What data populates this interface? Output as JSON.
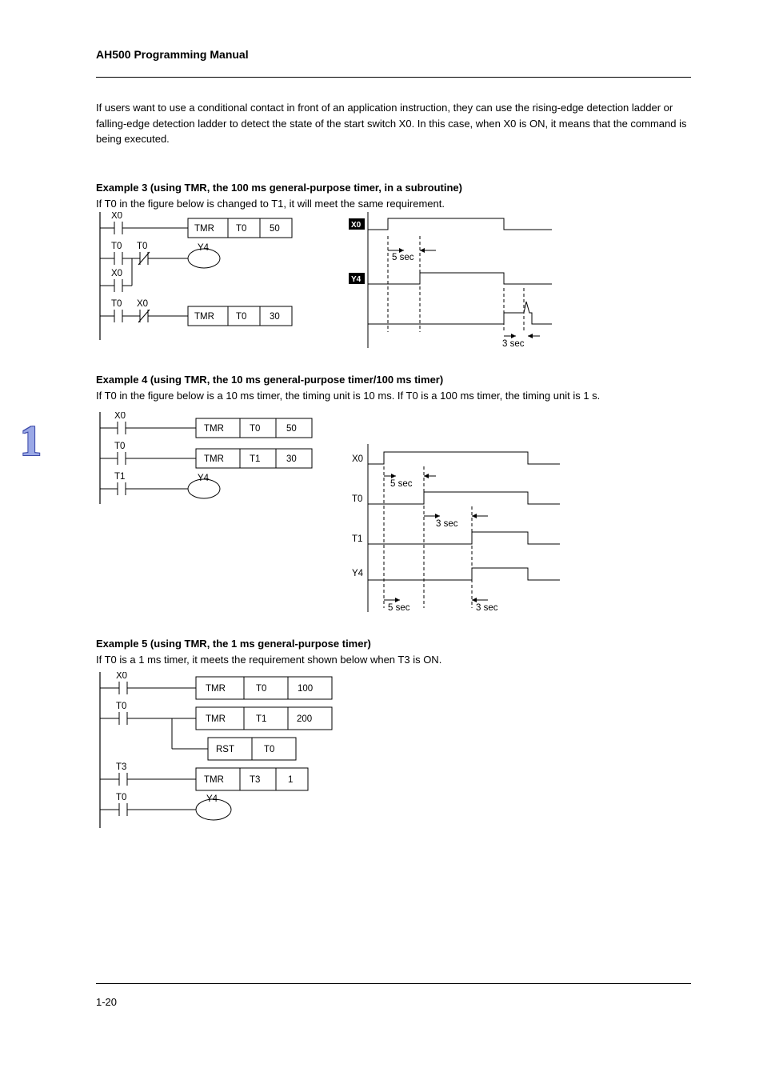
{
  "header": "AH500 Programming Manual",
  "footer": "1-20",
  "section_number": "1",
  "para_intro1": "If users want to use a conditional contact in front of an application instruction, they can use the rising-edge detection ladder or falling-edge detection ladder to detect the state of the start switch X0. In this case, when X0 is ON, it means that the command is being executed.",
  "ex3_title": "Example 3 (using TMR, the 100 ms general-purpose timer, in a subroutine)",
  "ex3_desc": "If T0 in the figure below is changed to T1, it will meet the same requirement.",
  "ex4_title": "Example 4 (using TMR, the 10 ms general-purpose timer/100 ms timer)",
  "ex4_desc": "If T0 in the figure below is a 10 ms timer, the timing unit is 10 ms. If T0 is a 100 ms timer, the timing unit is 1 s.",
  "ex5_title": "Example 5 (using TMR, the 1 ms general-purpose timer)",
  "ex5_desc": "If T0 is a 1 ms timer, it meets the requirement shown below when T3 is ON.",
  "ladderA": {
    "l1": {
      "c": "X0",
      "inst": "TMR",
      "op1": "T0",
      "op2": "50"
    },
    "l2": {
      "c1": "T0",
      "c2": "T0",
      "out": "Y4"
    },
    "l3": {
      "c": "X0"
    },
    "l4": {
      "c": "T0",
      "c2": "X0",
      "inst": "TMR",
      "op1": "T0",
      "op2": "30"
    }
  },
  "timingA": {
    "sig1": "X0",
    "sig2": "Y4",
    "dur1": "5 sec",
    "dur2": "3 sec"
  },
  "ladderB": {
    "l1": {
      "c": "X0",
      "inst": "TMR",
      "op1": "T0",
      "op2": "50"
    },
    "l2": {
      "c": "T0",
      "inst": "TMR",
      "op1": "T1",
      "op2": "30"
    },
    "l3": {
      "c": "T1",
      "out": "Y4"
    }
  },
  "timingB": {
    "sig1": "X0",
    "sig2": "T0",
    "sig3": "T1",
    "sig4": "Y4",
    "d1": "5 sec",
    "d2": "3 sec",
    "d3": "5 sec",
    "d4": "3 sec"
  },
  "ladderC": {
    "l1": {
      "c": "X0",
      "inst": "TMR",
      "op1": "T0",
      "op2": "100"
    },
    "l2": {
      "c": "T0",
      "inst1": "TMR",
      "op1a": "T1",
      "op1b": "200",
      "inst2": "RST",
      "op2": "T0"
    },
    "l3": {
      "c": "T3",
      "inst": "TMR",
      "op1": "T3",
      "op2": "1"
    },
    "l4": {
      "c": "T0",
      "out": "Y4"
    }
  }
}
